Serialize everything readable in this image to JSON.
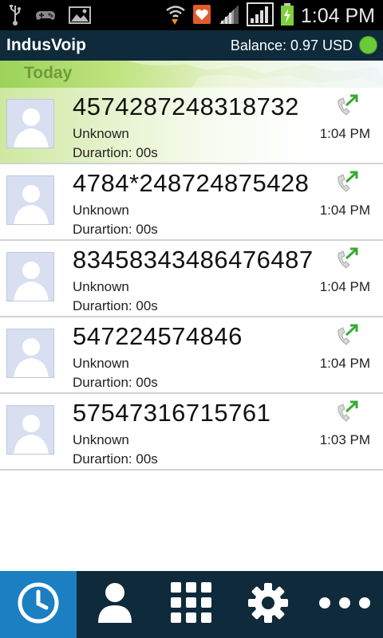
{
  "status_bar": {
    "time": "1:04 PM"
  },
  "app": {
    "title": "IndusVoip",
    "balance": "Balance: 0.97 USD",
    "status_color": "#6cc93a"
  },
  "section": {
    "title": "Today"
  },
  "calls": [
    {
      "number": "4574287248318732",
      "name": "Unknown",
      "time": "1:04 PM",
      "duration": "Durartion: 00s"
    },
    {
      "number": "4784*248724875428",
      "name": "Unknown",
      "time": "1:04 PM",
      "duration": "Durartion: 00s"
    },
    {
      "number": "83458343486476487",
      "name": "Unknown",
      "time": "1:04 PM",
      "duration": "Durartion: 00s"
    },
    {
      "number": "547224574846",
      "name": "Unknown",
      "time": "1:04 PM",
      "duration": "Durartion: 00s"
    },
    {
      "number": "57547316715761",
      "name": "Unknown",
      "time": "1:03 PM",
      "duration": "Durartion: 00s"
    }
  ],
  "nav": {
    "items": [
      {
        "icon": "clock-icon",
        "active": true
      },
      {
        "icon": "contact-icon",
        "active": false
      },
      {
        "icon": "dialpad-icon",
        "active": false
      },
      {
        "icon": "gear-icon",
        "active": false
      },
      {
        "icon": "more-icon",
        "active": false
      }
    ],
    "active_color": "#1b7fc2"
  },
  "colors": {
    "header_bg": "#0e2a3b",
    "accent_green": "#6cc93a"
  }
}
